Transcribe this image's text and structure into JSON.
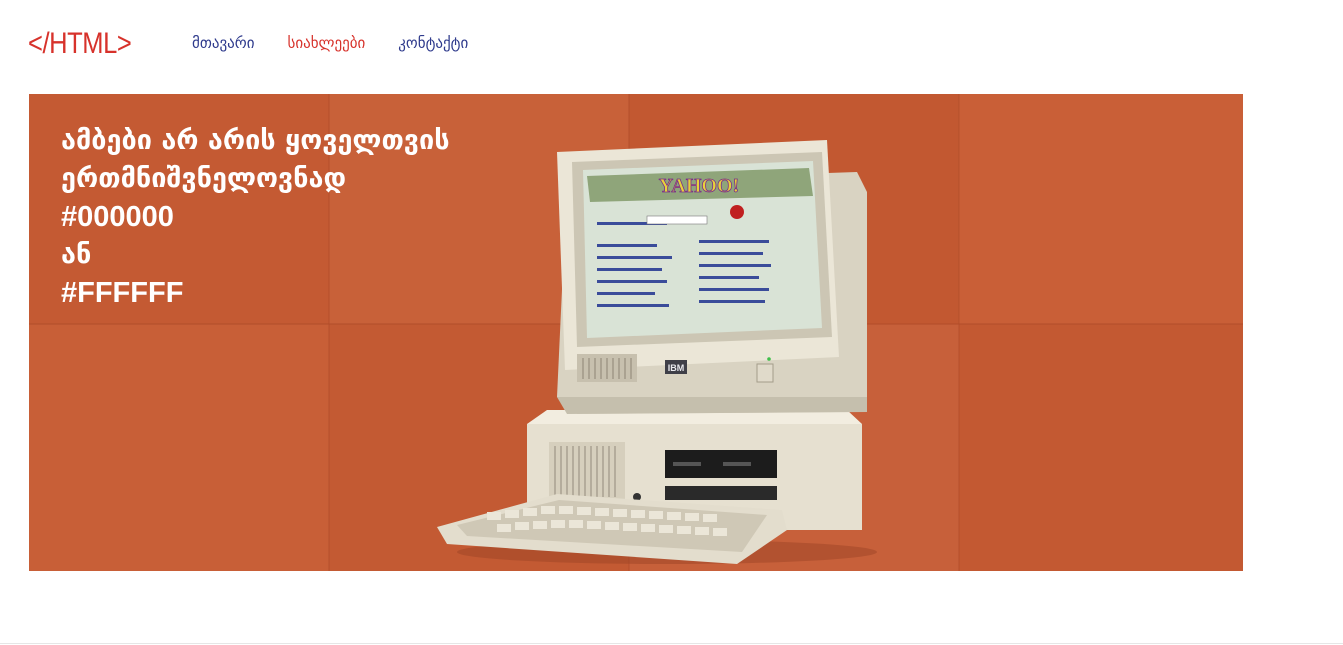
{
  "header": {
    "logo_text": "</HTML>",
    "nav": [
      {
        "label": "მთავარი",
        "active": false
      },
      {
        "label": "სიახლეები",
        "active": true
      },
      {
        "label": "კონტაქტი",
        "active": false
      }
    ]
  },
  "hero": {
    "lines": [
      "ამბები არ არის ყოველთვის",
      "ერთმნიშვნელოვნად",
      "#000000",
      "ან",
      "#FFFFFF"
    ],
    "screen_brand": "YAHOO!",
    "computer_brand": "IBM",
    "background_color": "#c65d35"
  },
  "colors": {
    "accent": "#d7322b",
    "nav_link": "#2e3a8c"
  }
}
